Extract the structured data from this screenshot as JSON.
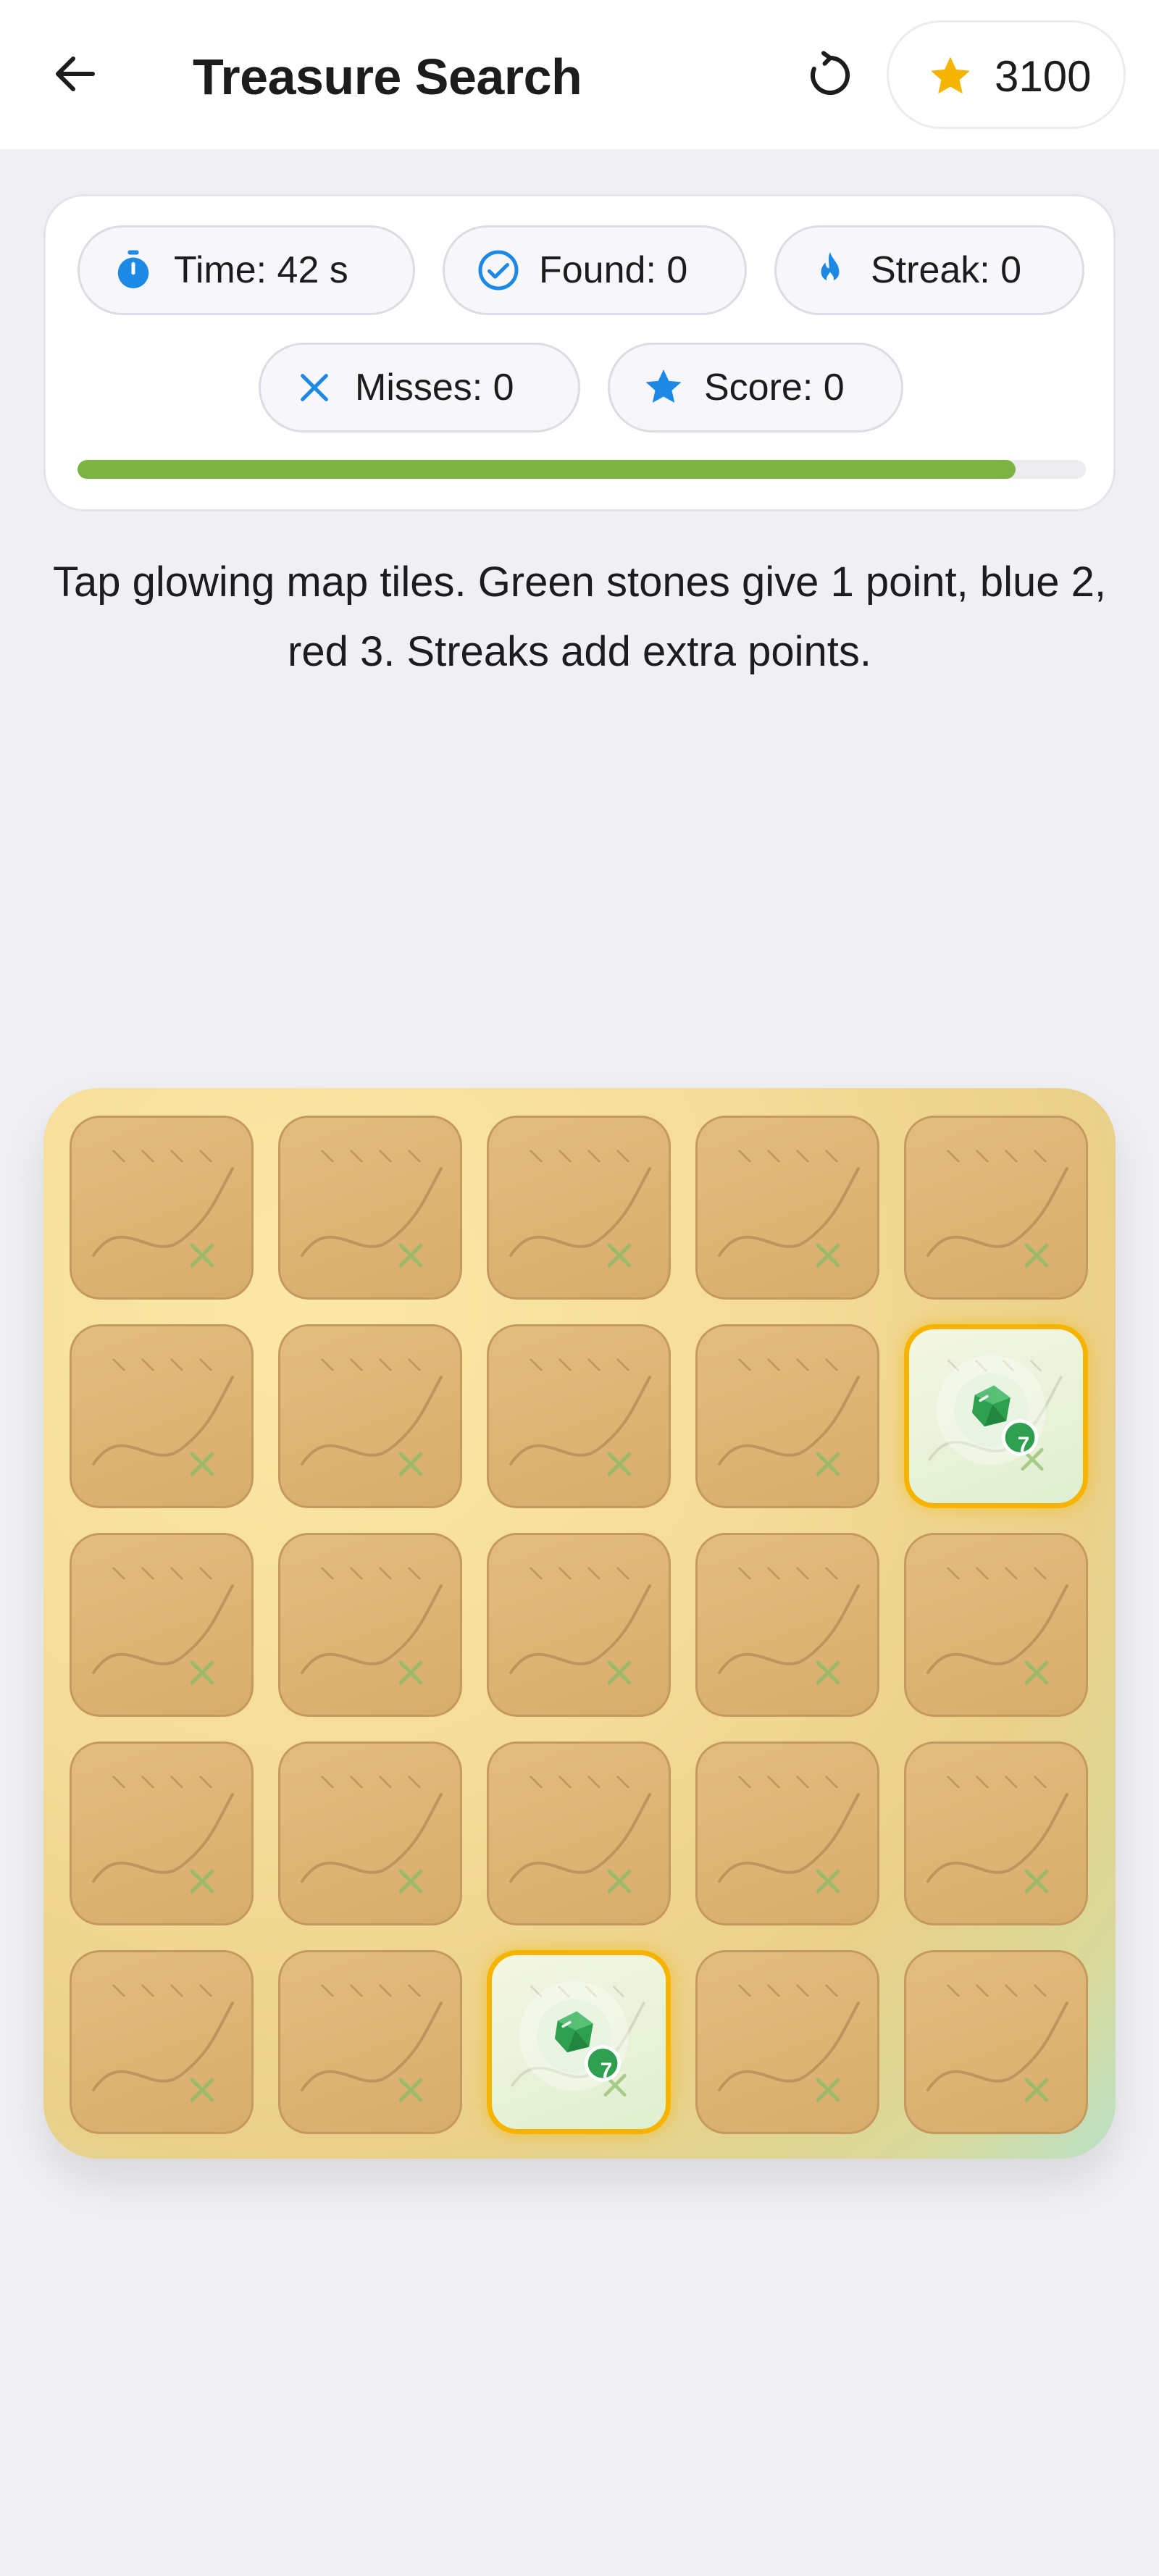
{
  "header": {
    "title": "Treasure Search",
    "back_icon": "arrow-left-icon",
    "reset_icon": "refresh-icon",
    "coins_icon": "star-icon",
    "coins": "3100"
  },
  "stats": {
    "time": "Time: 42 s",
    "found": "Found: 0",
    "streak": "Streak: 0",
    "misses": "Misses: 0",
    "score": "Score: 0",
    "progress_fraction": 0.93
  },
  "instructions": "Tap glowing map tiles. Green stones give 1 point, blue 2, red 3. Streaks add extra points.",
  "board": {
    "rows": 5,
    "cols": 5,
    "glowing_tiles": [
      {
        "row": 1,
        "col": 4,
        "stone": "green",
        "badge": "7"
      },
      {
        "row": 4,
        "col": 2,
        "stone": "green",
        "badge": "7"
      }
    ]
  },
  "colors": {
    "accent": "#1e88e5",
    "progress": "#7cb342",
    "glow_border": "#f5b400",
    "stone_green": "#2e9e4f"
  }
}
